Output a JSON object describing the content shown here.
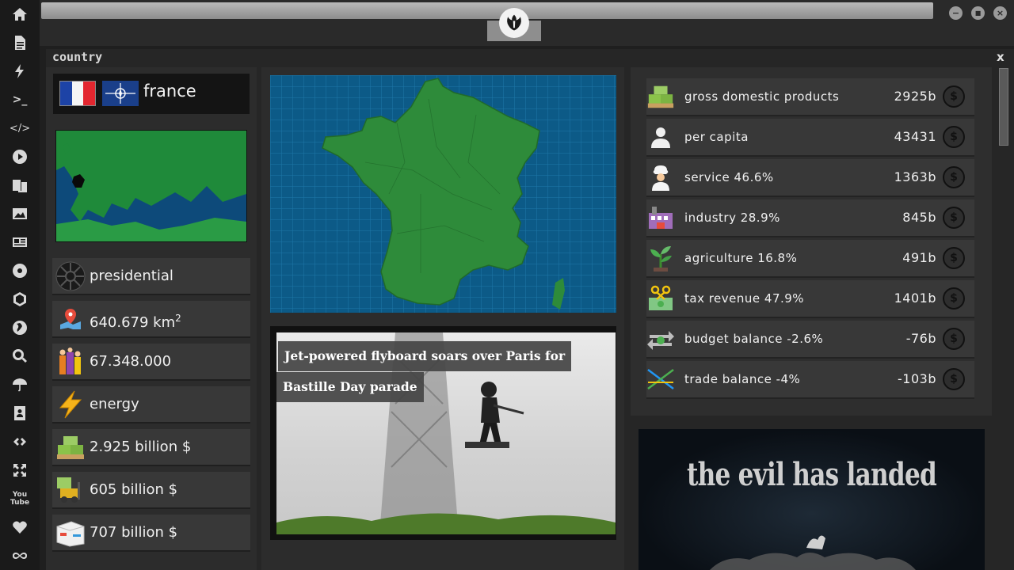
{
  "sidebar": {
    "items": [
      {
        "name": "home-icon"
      },
      {
        "name": "document-icon"
      },
      {
        "name": "lightning-icon"
      },
      {
        "name": "terminal-icon"
      },
      {
        "name": "code-icon"
      },
      {
        "name": "play-icon"
      },
      {
        "name": "translate-icon"
      },
      {
        "name": "image-icon"
      },
      {
        "name": "newspaper-icon"
      },
      {
        "name": "emblem-icon"
      },
      {
        "name": "hexagon-icon"
      },
      {
        "name": "globe-icon"
      },
      {
        "name": "search-icon"
      },
      {
        "name": "umbrella-icon"
      },
      {
        "name": "contact-icon"
      },
      {
        "name": "link-icon"
      },
      {
        "name": "expand-icon"
      },
      {
        "name": "youtube-icon"
      },
      {
        "name": "heart-icon"
      },
      {
        "name": "infinity-icon"
      }
    ],
    "youtube_label": "You\nTube"
  },
  "window": {
    "emblem_icon": "rebel-alliance-icon",
    "minimize": "−",
    "maximize": "■",
    "close": "×"
  },
  "panel": {
    "title": "country",
    "close": "x"
  },
  "country": {
    "name": "france",
    "stats": [
      {
        "icon": "empire-icon",
        "text": "presidential"
      },
      {
        "icon": "map-pin-icon",
        "text": "640.679 km",
        "sup": "2"
      },
      {
        "icon": "population-icon",
        "text": "67.348.000"
      },
      {
        "icon": "energy-icon",
        "text": "energy"
      },
      {
        "icon": "money-stack-icon",
        "text": "2.925 billion $"
      },
      {
        "icon": "forklift-icon",
        "text": "605 billion $"
      },
      {
        "icon": "shipping-box-icon",
        "text": "707 billion $"
      }
    ]
  },
  "news": {
    "headline_line1": "Jet-powered flyboard soars over Paris for",
    "headline_line2": "Bastille Day parade"
  },
  "economy": [
    {
      "icon": "money-stack-icon",
      "label": "gross domestic products",
      "value": "2925b"
    },
    {
      "icon": "person-icon",
      "label": "per capita",
      "value": "43431"
    },
    {
      "icon": "chef-icon",
      "label": "service 46.6%",
      "value": "1363b"
    },
    {
      "icon": "factory-icon",
      "label": "industry 28.9%",
      "value": "845b"
    },
    {
      "icon": "sprout-icon",
      "label": "agriculture 16.8%",
      "value": "491b"
    },
    {
      "icon": "tax-icon",
      "label": "tax revenue 47.9%",
      "value": "1401b"
    },
    {
      "icon": "exchange-icon",
      "label": "budget balance -2.6%",
      "value": "-76b"
    },
    {
      "icon": "trade-icon",
      "label": "trade balance -4%",
      "value": "-103b"
    }
  ],
  "coin_symbol": "$",
  "ad": {
    "text": "the evil has landed"
  }
}
